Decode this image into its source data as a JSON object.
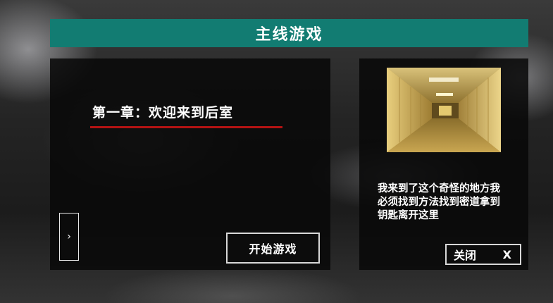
{
  "header": {
    "title": "主线游戏"
  },
  "chapter": {
    "title": "第一章：欢迎来到后室"
  },
  "buttons": {
    "next_label": "›",
    "start_label": "开始游戏",
    "close_label": "关闭",
    "close_icon": "X"
  },
  "story": {
    "text": "我来到了这个奇怪的地方我必须找到方法找到密道拿到钥匙离开这里"
  },
  "preview": {
    "icon": "backrooms-hallway-image"
  },
  "colors": {
    "header_bg": "#127c72",
    "underline": "#b41313",
    "panel_bg": "#080808",
    "text": "#ffffff"
  }
}
